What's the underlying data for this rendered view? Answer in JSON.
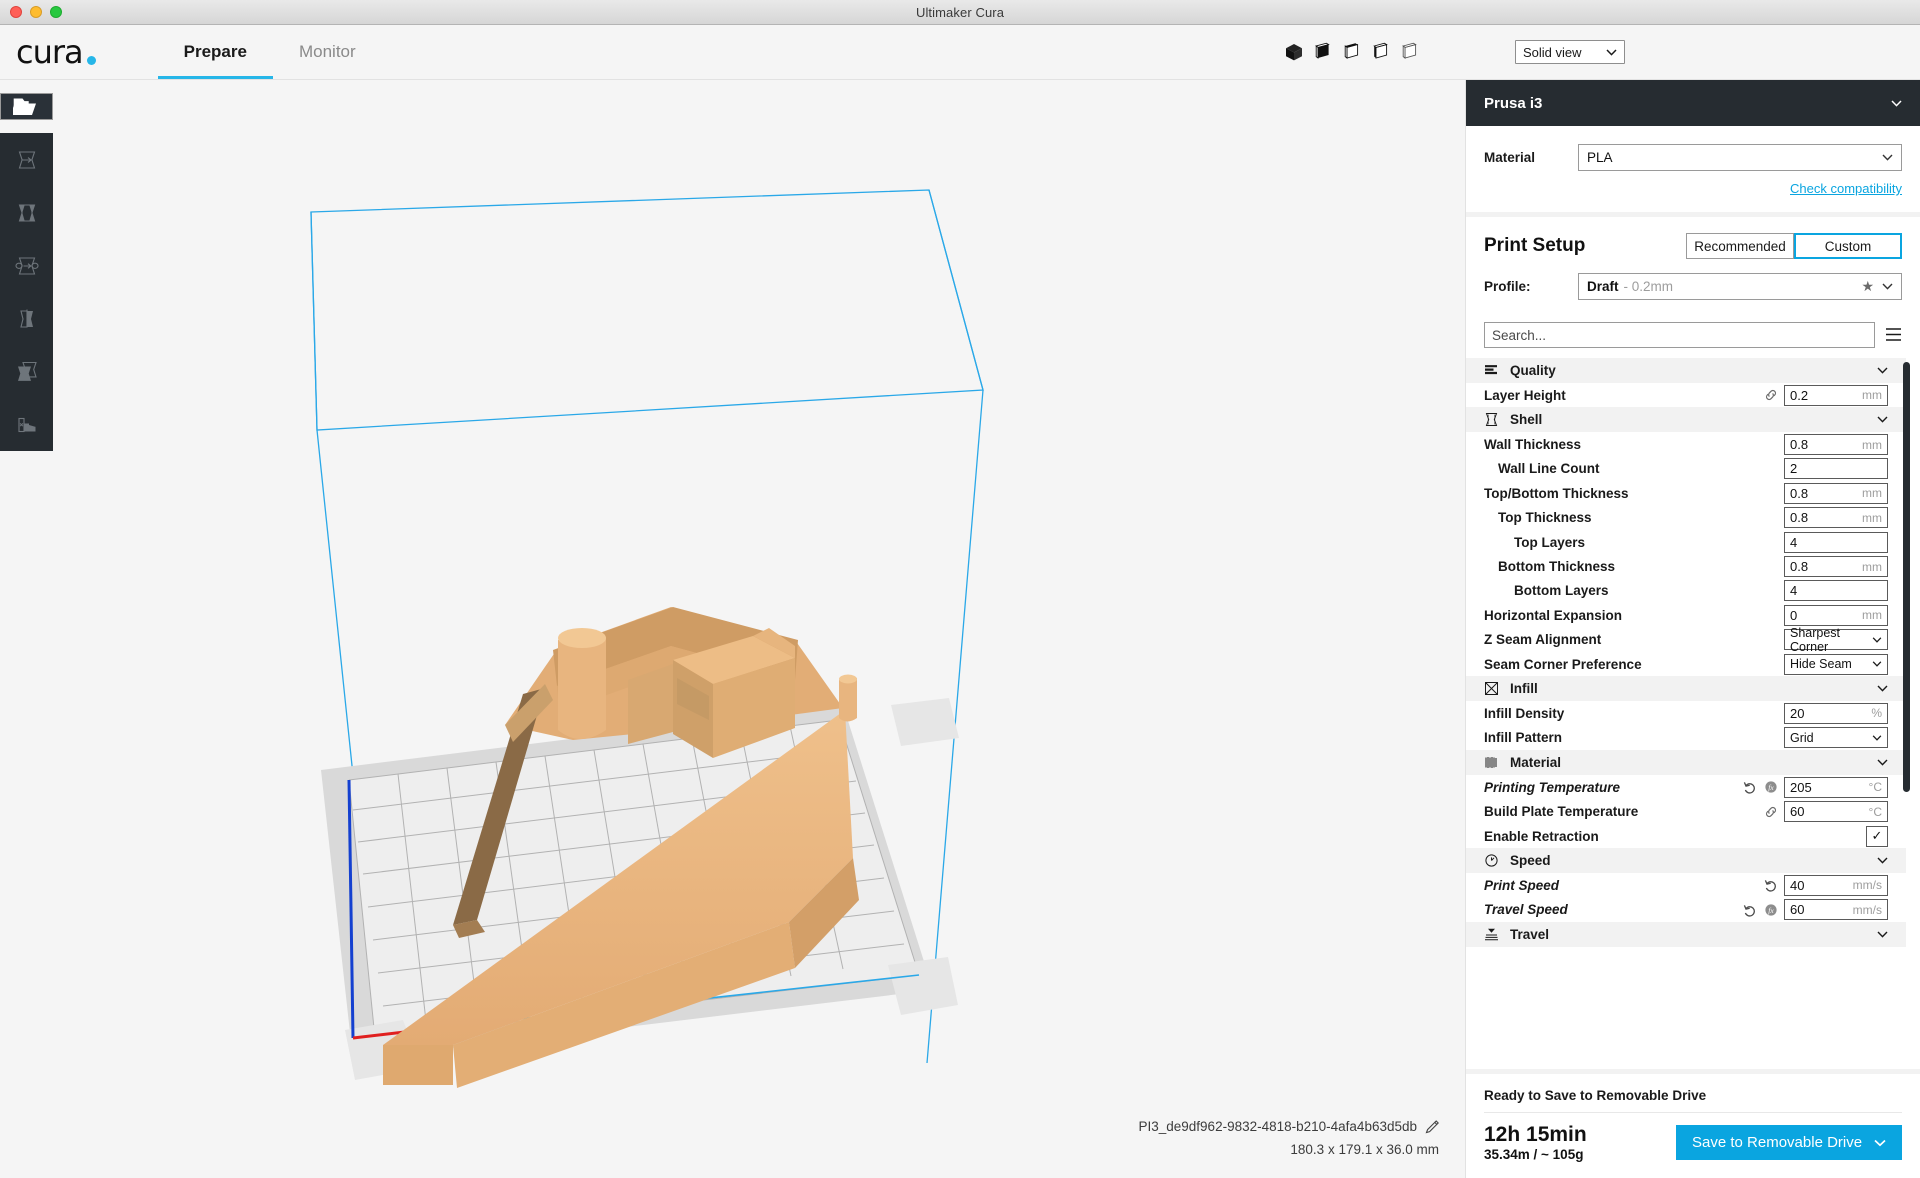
{
  "window": {
    "title": "Ultimaker Cura"
  },
  "brand": {
    "word": "cura",
    "dot": "brand-dot"
  },
  "tabs": [
    {
      "label": "Prepare",
      "active": true
    },
    {
      "label": "Monitor",
      "active": false
    }
  ],
  "view_icons": [
    {
      "name": "view-3d-icon"
    },
    {
      "name": "view-front-icon"
    },
    {
      "name": "view-top-icon"
    },
    {
      "name": "view-left-icon"
    },
    {
      "name": "view-right-icon"
    }
  ],
  "view_mode": {
    "value": "Solid view",
    "chevron": "chevron-down-icon"
  },
  "left_toolbar": [
    {
      "name": "open-file-icon",
      "selected": true
    },
    {
      "name": "move-tool-icon",
      "selected": false
    },
    {
      "name": "scale-tool-icon",
      "selected": false
    },
    {
      "name": "rotate-tool-icon",
      "selected": false
    },
    {
      "name": "mirror-tool-icon",
      "selected": false
    },
    {
      "name": "per-model-settings-icon",
      "selected": false
    },
    {
      "name": "support-blocker-icon",
      "selected": false
    }
  ],
  "model": {
    "filename": "PI3_de9df962-9832-4818-b210-4afa4b63d5db",
    "dimensions": "180.3 x 179.1 x 36.0 mm",
    "edit_icon": "pencil-icon",
    "color": "#e5b177",
    "plate_color": "#e8e8e8"
  },
  "printer": {
    "name": "Prusa i3",
    "chevron": "chevron-down-icon"
  },
  "material": {
    "label": "Material",
    "value": "PLA",
    "check_compatibility": "Check compatibility",
    "link_color": "#0aa5e0"
  },
  "print_setup": {
    "title": "Print Setup",
    "modes": [
      {
        "label": "Recommended",
        "active": false
      },
      {
        "label": "Custom",
        "active": true
      }
    ],
    "profile_label": "Profile:",
    "profile_name": "Draft",
    "profile_sub": "- 0.2mm",
    "star_icon": "star-icon"
  },
  "search": {
    "placeholder": "Search...",
    "value": "",
    "menu_icon": "hamburger-menu-icon"
  },
  "settings": [
    {
      "type": "category",
      "icon": "quality-icon",
      "name": "Quality",
      "chevron": "chevron-down-icon",
      "rows": [
        {
          "name": "Layer Height",
          "indent": 0,
          "overridden": false,
          "icons": [
            "link-icon"
          ],
          "field": "input",
          "value": "0.2",
          "unit": "mm"
        }
      ]
    },
    {
      "type": "category",
      "icon": "shell-icon",
      "name": "Shell",
      "chevron": "chevron-down-icon",
      "rows": [
        {
          "name": "Wall Thickness",
          "indent": 0,
          "overridden": false,
          "icons": [],
          "field": "input",
          "value": "0.8",
          "unit": "mm"
        },
        {
          "name": "Wall Line Count",
          "indent": 1,
          "overridden": false,
          "icons": [],
          "field": "input",
          "value": "2",
          "unit": ""
        },
        {
          "name": "Top/Bottom Thickness",
          "indent": 0,
          "overridden": false,
          "icons": [],
          "field": "input",
          "value": "0.8",
          "unit": "mm"
        },
        {
          "name": "Top Thickness",
          "indent": 1,
          "overridden": false,
          "icons": [],
          "field": "input",
          "value": "0.8",
          "unit": "mm"
        },
        {
          "name": "Top Layers",
          "indent": 2,
          "overridden": false,
          "icons": [],
          "field": "input",
          "value": "4",
          "unit": ""
        },
        {
          "name": "Bottom Thickness",
          "indent": 1,
          "overridden": false,
          "icons": [],
          "field": "input",
          "value": "0.8",
          "unit": "mm"
        },
        {
          "name": "Bottom Layers",
          "indent": 2,
          "overridden": false,
          "icons": [],
          "field": "input",
          "value": "4",
          "unit": ""
        },
        {
          "name": "Horizontal Expansion",
          "indent": 0,
          "overridden": false,
          "icons": [],
          "field": "input",
          "value": "0",
          "unit": "mm"
        },
        {
          "name": "Z Seam Alignment",
          "indent": 0,
          "overridden": false,
          "icons": [],
          "field": "dropdown",
          "value": "Sharpest Corner",
          "unit": ""
        },
        {
          "name": "Seam Corner Preference",
          "indent": 0,
          "overridden": false,
          "icons": [],
          "field": "dropdown",
          "value": "Hide Seam",
          "unit": ""
        }
      ]
    },
    {
      "type": "category",
      "icon": "infill-icon",
      "name": "Infill",
      "chevron": "chevron-down-icon",
      "rows": [
        {
          "name": "Infill Density",
          "indent": 0,
          "overridden": false,
          "icons": [],
          "field": "input",
          "value": "20",
          "unit": "%"
        },
        {
          "name": "Infill Pattern",
          "indent": 0,
          "overridden": false,
          "icons": [],
          "field": "dropdown",
          "value": "Grid",
          "unit": ""
        }
      ]
    },
    {
      "type": "category",
      "icon": "material-icon",
      "name": "Material",
      "chevron": "chevron-down-icon",
      "rows": [
        {
          "name": "Printing Temperature",
          "indent": 0,
          "overridden": true,
          "icons": [
            "revert-icon",
            "function-icon"
          ],
          "field": "input",
          "value": "205",
          "unit": "°C"
        },
        {
          "name": "Build Plate Temperature",
          "indent": 0,
          "overridden": false,
          "icons": [
            "link-icon"
          ],
          "field": "input",
          "value": "60",
          "unit": "°C"
        },
        {
          "name": "Enable Retraction",
          "indent": 0,
          "overridden": false,
          "icons": [],
          "field": "checkbox",
          "value": "✓",
          "unit": ""
        }
      ]
    },
    {
      "type": "category",
      "icon": "speed-icon",
      "name": "Speed",
      "chevron": "chevron-down-icon",
      "rows": [
        {
          "name": "Print Speed",
          "indent": 0,
          "overridden": true,
          "icons": [
            "revert-icon"
          ],
          "field": "input",
          "value": "40",
          "unit": "mm/s"
        },
        {
          "name": "Travel Speed",
          "indent": 0,
          "overridden": true,
          "icons": [
            "revert-icon",
            "function-icon"
          ],
          "field": "input",
          "value": "60",
          "unit": "mm/s"
        }
      ]
    },
    {
      "type": "category",
      "icon": "travel-icon",
      "name": "Travel",
      "chevron": "chevron-down-icon",
      "rows": []
    }
  ],
  "job": {
    "status": "Ready to Save to Removable Drive",
    "time": "12h 15min",
    "material": "35.34m / ~ 105g",
    "save_label": "Save to Removable Drive",
    "save_chevron": "chevron-down-icon",
    "accent": "#0aa5e0"
  }
}
